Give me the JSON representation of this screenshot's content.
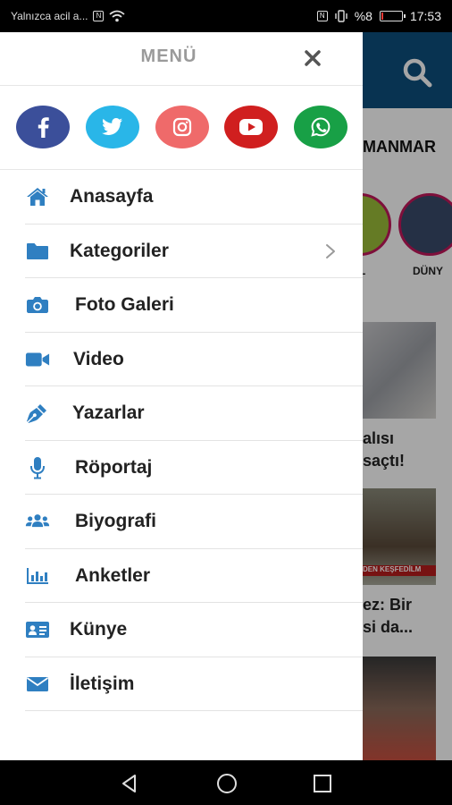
{
  "status_bar": {
    "carrier_text": "Yalnızca acil a...",
    "battery_text": "%8",
    "time": "17:53",
    "battery_level": 0.08
  },
  "background_app": {
    "topic_text": "MANMAR",
    "story_labels": [
      "L",
      "DÜNY"
    ],
    "headline_1": [
      "alısı",
      "saçtı!"
    ],
    "headline_2": [
      "ez: Bir",
      "si da..."
    ],
    "image_caption": "DEN KEŞFEDİLM",
    "colors": {
      "header": "#0d4f7d",
      "story_ring": "#c2185b"
    }
  },
  "drawer": {
    "title": "MENÜ",
    "close_icon": "close-icon",
    "social": [
      {
        "name": "facebook",
        "icon": "facebook-icon",
        "color": "#3b4f9a"
      },
      {
        "name": "twitter",
        "icon": "twitter-icon",
        "color": "#29b6e8"
      },
      {
        "name": "instagram",
        "icon": "instagram-icon",
        "color": "#ef6a6a"
      },
      {
        "name": "youtube",
        "icon": "youtube-icon",
        "color": "#d01f1f"
      },
      {
        "name": "whatsapp",
        "icon": "whatsapp-icon",
        "color": "#18a046"
      }
    ],
    "icon_color": "#2f7fc1",
    "items": [
      {
        "label": "Anasayfa",
        "icon": "home-icon"
      },
      {
        "label": "Kategoriler",
        "icon": "folder-icon",
        "has_submenu": true
      },
      {
        "label": "Foto Galeri",
        "icon": "camera-icon"
      },
      {
        "label": "Video",
        "icon": "video-camera-icon"
      },
      {
        "label": "Yazarlar",
        "icon": "pen-icon"
      },
      {
        "label": "Röportaj",
        "icon": "microphone-icon"
      },
      {
        "label": "Biyografi",
        "icon": "users-icon"
      },
      {
        "label": "Anketler",
        "icon": "bar-chart-icon"
      },
      {
        "label": "Künye",
        "icon": "id-card-icon"
      },
      {
        "label": "İletişim",
        "icon": "envelope-icon"
      }
    ]
  },
  "nav_bar": {
    "back_icon": "back-icon",
    "home_icon": "home-circle-icon",
    "recents_icon": "recents-icon"
  }
}
